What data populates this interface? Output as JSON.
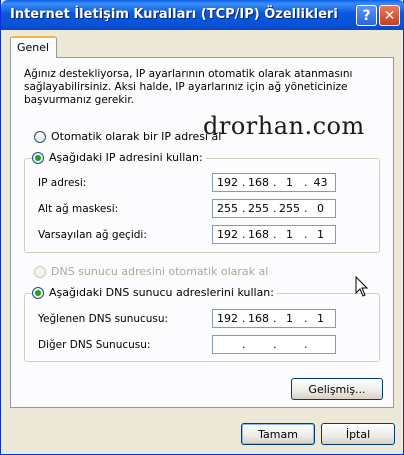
{
  "window": {
    "title": "Internet İletişim Kuralları (TCP/IP) Özellikleri",
    "help_glyph": "?",
    "close_glyph": "✕"
  },
  "tabs": [
    {
      "label": "Genel",
      "active": true
    }
  ],
  "intro_text": "Ağınız destekliyorsa, IP ayarlarının otomatik olarak atanmasını sağlayabilirsiniz. Aksi halde, IP ayarlarınız için ağ yöneticinize başvurmanız gerekir.",
  "ip_section": {
    "auto_option": {
      "label": "Otomatik olarak bir IP adresi al",
      "selected": false
    },
    "manual_option": {
      "label": "Aşağıdaki IP adresini kullan:",
      "selected": true
    },
    "fields": [
      {
        "label": "IP adresi:",
        "value": [
          "192",
          "168",
          "1",
          "43"
        ]
      },
      {
        "label": "Alt ağ maskesi:",
        "value": [
          "255",
          "255",
          "255",
          "0"
        ]
      },
      {
        "label": "Varsayılan ağ geçidi:",
        "value": [
          "192",
          "168",
          "1",
          "1"
        ]
      }
    ]
  },
  "dns_section": {
    "auto_option": {
      "label": "DNS sunucu adresini otomatik olarak al",
      "selected": false,
      "disabled": true
    },
    "manual_option": {
      "label": "Aşağıdaki DNS sunucu adreslerini kullan:",
      "selected": true
    },
    "fields": [
      {
        "label": "Yeğlenen DNS sunucusu:",
        "value": [
          "192",
          "168",
          "1",
          "1"
        ]
      },
      {
        "label": "Diğer DNS Sunucusu:",
        "value": [
          "",
          "",
          "",
          ""
        ]
      }
    ]
  },
  "watermark": "drorhan.com",
  "buttons": {
    "advanced": "Gelişmiş...",
    "ok": "Tamam",
    "cancel": "İptal"
  },
  "colors": {
    "titlebar": "#0a57df",
    "radio_selected": "#21a121",
    "tab_highlight": "#f9b240"
  }
}
